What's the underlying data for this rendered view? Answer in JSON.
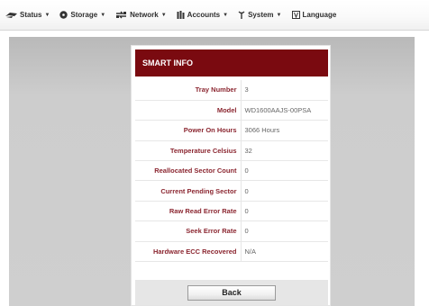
{
  "nav": {
    "items": [
      {
        "label": "Status",
        "icon": "status-icon"
      },
      {
        "label": "Storage",
        "icon": "storage-icon"
      },
      {
        "label": "Network",
        "icon": "network-icon"
      },
      {
        "label": "Accounts",
        "icon": "accounts-icon"
      },
      {
        "label": "System",
        "icon": "system-icon"
      },
      {
        "label": "Language",
        "icon": "language-icon"
      }
    ]
  },
  "panel": {
    "title": "SMART INFO",
    "rows": [
      {
        "label": "Tray Number",
        "value": "3"
      },
      {
        "label": "Model",
        "value": "WD1600AAJS-00PSA"
      },
      {
        "label": "Power On Hours",
        "value": "3066 Hours"
      },
      {
        "label": "Temperature Celsius",
        "value": "32"
      },
      {
        "label": "Reallocated Sector Count",
        "value": "0"
      },
      {
        "label": "Current Pending Sector",
        "value": "0"
      },
      {
        "label": "Raw Read Error Rate",
        "value": "0"
      },
      {
        "label": "Seek Error Rate",
        "value": "0"
      },
      {
        "label": "Hardware ECC Recovered",
        "value": "N/A"
      }
    ],
    "back_label": "Back"
  },
  "colors": {
    "header_bg": "#7a0a10",
    "label_text": "#8b2630",
    "value_text": "#666666",
    "workarea": "#cfcfcf"
  }
}
